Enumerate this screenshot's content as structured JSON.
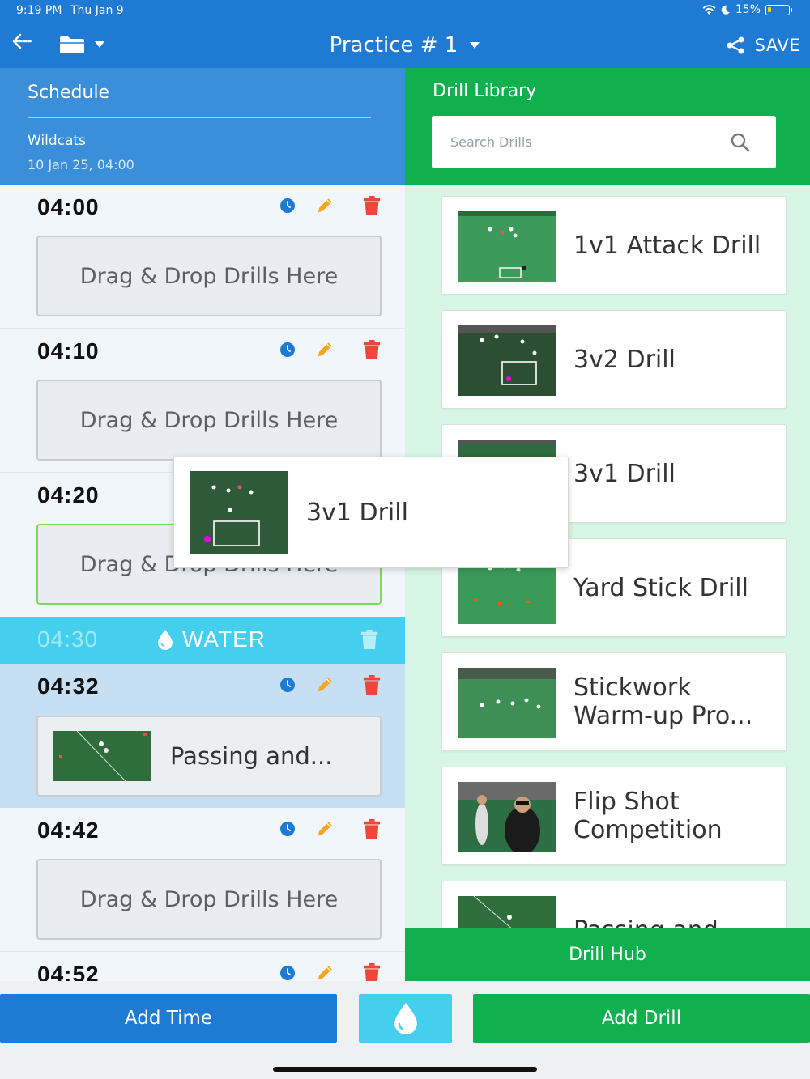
{
  "status_bar": {
    "time": "9:19 PM",
    "date": "Thu Jan 9",
    "battery": "15%"
  },
  "nav": {
    "title": "Practice # 1",
    "save_label": "SAVE"
  },
  "schedule": {
    "header": "Schedule",
    "team": "Wildcats",
    "date": "10 Jan 25, 04:00",
    "slots": [
      {
        "time": "04:00",
        "drop_text": "Drag & Drop Drills Here"
      },
      {
        "time": "04:10",
        "drop_text": "Drag & Drop Drills Here"
      },
      {
        "time": "04:20",
        "drop_text": "Drag & Drop Drills Here"
      },
      {
        "time": "04:32",
        "drill": "Passing and..."
      },
      {
        "time": "04:42",
        "drop_text": "Drag & Drop Drills Here"
      },
      {
        "time": "04:52"
      }
    ],
    "water": {
      "time": "04:30",
      "label": "WATER"
    }
  },
  "library": {
    "header": "Drill Library",
    "search_placeholder": "Search Drills",
    "items": [
      "1v1 Attack Drill",
      "3v2 Drill",
      "3v1 Drill",
      "Yard Stick Drill",
      "Stickwork Warm-up Pro...",
      "Flip Shot Competition",
      "Passing and"
    ],
    "hub_label": "Drill Hub"
  },
  "dragging": {
    "label": "3v1 Drill"
  },
  "bottom": {
    "add_time": "Add Time",
    "add_drill": "Add Drill"
  },
  "colors": {
    "blue": "#1e7ad3",
    "green": "#10b04f",
    "water": "#45cfee",
    "delete": "#f0453a",
    "edit": "#f5a623"
  }
}
